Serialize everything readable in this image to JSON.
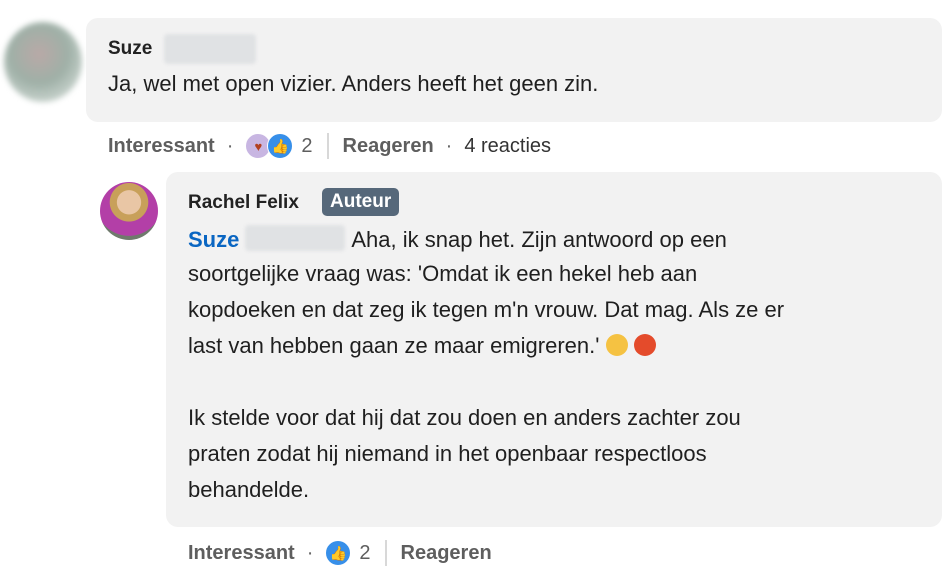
{
  "comment1": {
    "author": "Suze",
    "text": "Ja, wel met open vizier. Anders heeft het geen zin.",
    "actions": {
      "react_label": "Interessant",
      "reaction_count": "2",
      "reply_label": "Reageren",
      "replies": "4 reacties"
    }
  },
  "reply1": {
    "author": "Rachel Felix",
    "badge": "Auteur",
    "mention": "Suze",
    "line1": "Aha, ik snap het. Zijn antwoord op een",
    "line2": "soortgelijke vraag was: 'Omdat ik een hekel heb aan",
    "line3": "kopdoeken en dat zeg ik tegen m'n vrouw. Dat mag. Als ze er",
    "line4": "last van hebben gaan ze maar emigreren.'",
    "para2_line1": "Ik stelde voor dat hij dat zou doen en anders zachter zou",
    "para2_line2": "praten zodat hij niemand in het openbaar respectloos",
    "para2_line3": "behandelde.",
    "actions": {
      "react_label": "Interessant",
      "reaction_count": "2",
      "reply_label": "Reageren"
    }
  },
  "icons": {
    "like": "thumbs-up-icon",
    "love": "heart-hands-icon",
    "cry": "crying-face-emoji",
    "angry": "angry-face-emoji"
  },
  "colors": {
    "mention": "#0a66c2",
    "badge": "#56687a",
    "bubble": "#f2f2f2"
  }
}
